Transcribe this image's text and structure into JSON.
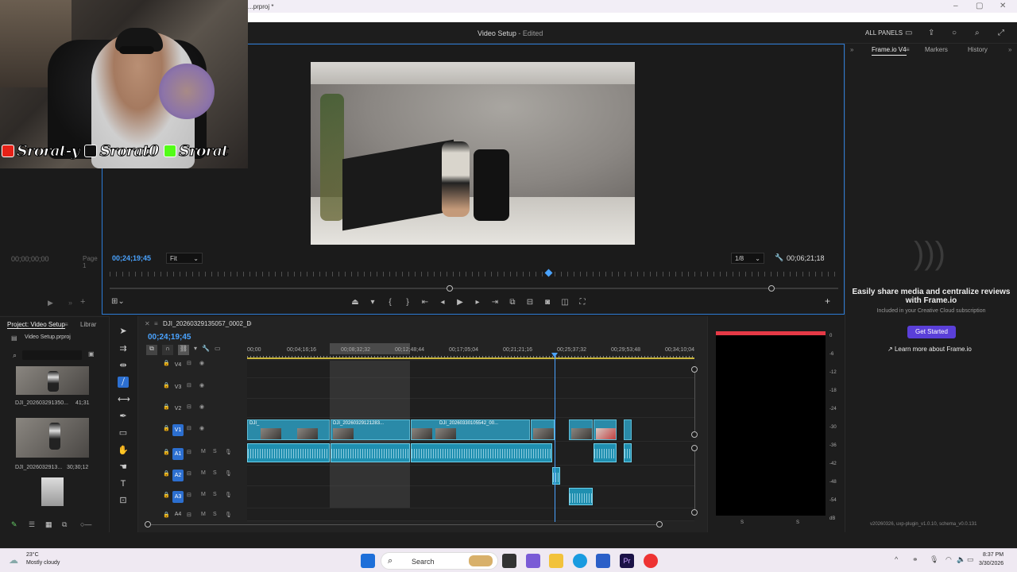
{
  "window": {
    "filename": "...prproj *",
    "app_title": "Video Setup",
    "app_status": "- Edited",
    "all_panels": "ALL PANELS"
  },
  "webcam_overlay": {
    "handles": [
      {
        "platform": "youtube-icon",
        "text": "Srorat-y"
      },
      {
        "platform": "tiktok-icon",
        "text": "Srorat0"
      },
      {
        "platform": "kick-icon",
        "text": "Srorat"
      }
    ]
  },
  "source_monitor": {
    "timecode": "00;00;00;00",
    "page": "Page 1"
  },
  "program_monitor": {
    "timecode": "00;24;19;45",
    "fit": "Fit",
    "resolution": "1/8",
    "duration": "00;06;21;18"
  },
  "right_panel": {
    "tabs": [
      "Frame.io V4",
      "Markers",
      "History"
    ],
    "headline": "Easily share media and centralize reviews with Frame.io",
    "subline": "Included in your Creative Cloud subscription",
    "get_started": "Get Started",
    "learn_more": "Learn more about Frame.io",
    "version": "v20260326, uxp-plugin_v1.0.10, schema_v0.0.131"
  },
  "project_panel": {
    "tab_project": "Project: Video Setup",
    "tab_library": "Librar",
    "project_file": "Video Setup.prproj",
    "items": [
      {
        "name": "DJI_202603291350...",
        "duration": "41;31"
      },
      {
        "name": "DJI_2026032913...",
        "duration": "30;30;12"
      },
      {
        "name": "",
        "duration": ""
      }
    ]
  },
  "timeline": {
    "sequence_name": "DJI_20260329135057_0002_D",
    "timecode": "00;24;19;45",
    "ruler_labels": [
      "00;00",
      "00;04;16;16",
      "00;08;32;32",
      "00;12;48;44",
      "00;17;05;04",
      "00;21;21;16",
      "00;25;37;32",
      "00;29;53;48",
      "00;34;10;04"
    ],
    "tracks": [
      {
        "id": "V4",
        "type": "video"
      },
      {
        "id": "V3",
        "type": "video"
      },
      {
        "id": "V2",
        "type": "video"
      },
      {
        "id": "V1",
        "type": "video"
      },
      {
        "id": "A1",
        "type": "audio"
      },
      {
        "id": "A2",
        "type": "audio"
      },
      {
        "id": "A3",
        "type": "audio"
      },
      {
        "id": "A4",
        "type": "audio"
      }
    ],
    "clip_labels": [
      "DJI_",
      "DJI_20260329121283...",
      "DJI_20260330105542_00..."
    ]
  },
  "audio_meter": {
    "db_labels": [
      "0",
      "-6",
      "-12",
      "-18",
      "-24",
      "-30",
      "-36",
      "-42",
      "-48",
      "-54",
      "dB"
    ],
    "channels": [
      "S",
      "S"
    ]
  },
  "taskbar": {
    "temperature": "23°C",
    "weather": "Mostly cloudy",
    "search_placeholder": "Search",
    "time": "8:37 PM",
    "date": "3/30/2026"
  },
  "colors": {
    "accent_blue": "#2c7bd6",
    "playhead": "#4aa3ff",
    "clip": "#2a8aa8",
    "frameio_button": "#5a3fd8",
    "meter_peak": "#e63946"
  }
}
